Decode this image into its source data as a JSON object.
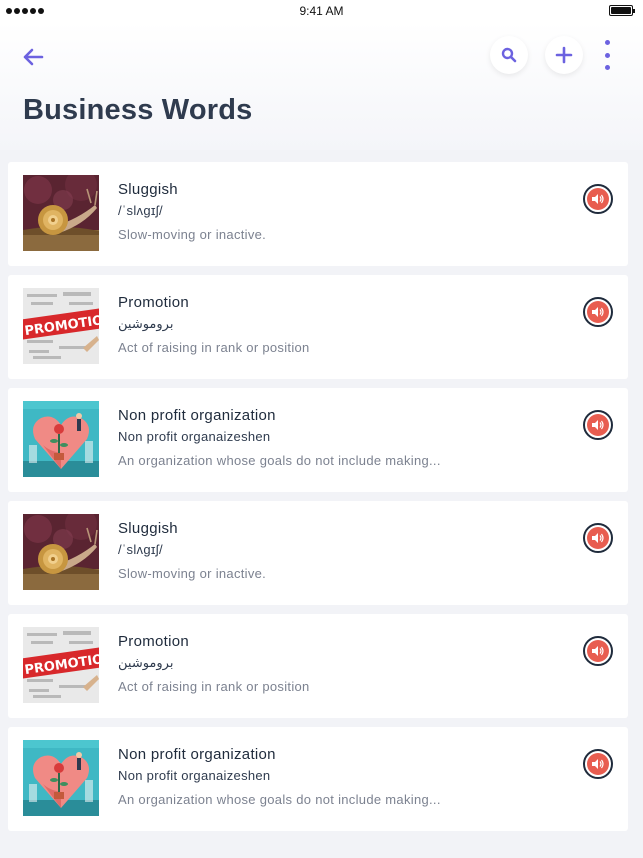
{
  "status_bar": {
    "time": "9:41 AM"
  },
  "header": {
    "title": "Business Words"
  },
  "colors": {
    "accent": "#6c62e0",
    "sound": "#e85d50",
    "title": "#2f3b4e"
  },
  "words": [
    {
      "word": "Sluggish",
      "pronunciation": "/ˈslʌɡɪʃ/",
      "meaning": "Slow-moving or inactive.",
      "image": "snail"
    },
    {
      "word": "Promotion",
      "pronunciation": "بروموشين",
      "meaning": "Act of raising in rank or position",
      "image": "promotion"
    },
    {
      "word": "Non profit organization",
      "pronunciation": "Non profit organaizeshen",
      "meaning": "An organization whose goals do not include making...",
      "image": "heart"
    },
    {
      "word": "Sluggish",
      "pronunciation": "/ˈslʌɡɪʃ/",
      "meaning": "Slow-moving or inactive.",
      "image": "snail"
    },
    {
      "word": "Promotion",
      "pronunciation": "بروموشين",
      "meaning": "Act of raising in rank or position",
      "image": "promotion"
    },
    {
      "word": "Non profit organization",
      "pronunciation": "Non profit organaizeshen",
      "meaning": "An organization whose goals do not include making...",
      "image": "heart"
    }
  ],
  "thumb_text": {
    "promotion": "PROMOTION"
  }
}
